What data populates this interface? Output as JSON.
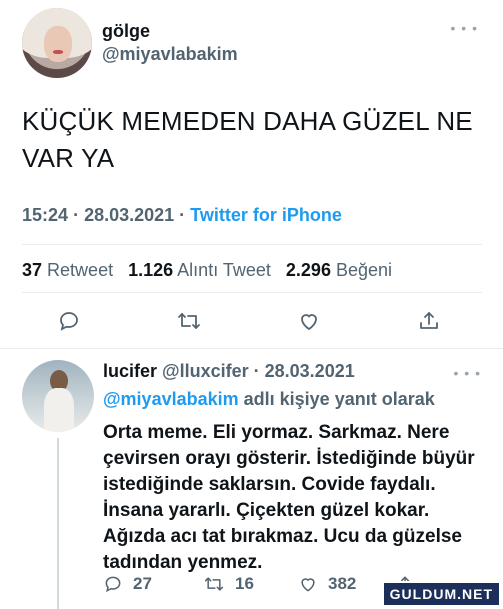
{
  "tweet": {
    "author_name": "gölge",
    "author_handle": "@miyavlabakim",
    "text": "KÜÇÜK MEMEDEN DAHA GÜZEL NE VAR YA",
    "time": "15:24",
    "date": "28.03.2021",
    "source": "Twitter for iPhone",
    "stats": {
      "retweets_count": "37",
      "retweets_label": "Retweet",
      "quotes_count": "1.126",
      "quotes_label": "Alıntı Tweet",
      "likes_count": "2.296",
      "likes_label": "Beğeni"
    },
    "icons": [
      "reply-icon",
      "retweet-icon",
      "like-icon",
      "share-icon"
    ]
  },
  "reply": {
    "author_name": "lucifer",
    "author_handle": "@lluxcifer",
    "date": "28.03.2021",
    "reply_to_handle": "@miyavlabakim",
    "reply_to_suffix": "adlı kişiye yanıt olarak",
    "text": "Orta meme. Eli yormaz. Sarkmaz. Nere çevirsen orayı gösterir. İstediğinde büyür istediğinde saklarsın. Covide faydalı. İnsana yararlı. Çiçekten güzel kokar. Ağızda acı tat bırakmaz. Ucu da güzelse tadından yenmez.",
    "replies_count": "27",
    "retweets_count": "16",
    "likes_count": "382"
  },
  "watermark": "GULDUM.NET",
  "colors": {
    "link": "#1d9bf0",
    "secondary_text": "#536471",
    "primary_text": "#0f1419"
  }
}
